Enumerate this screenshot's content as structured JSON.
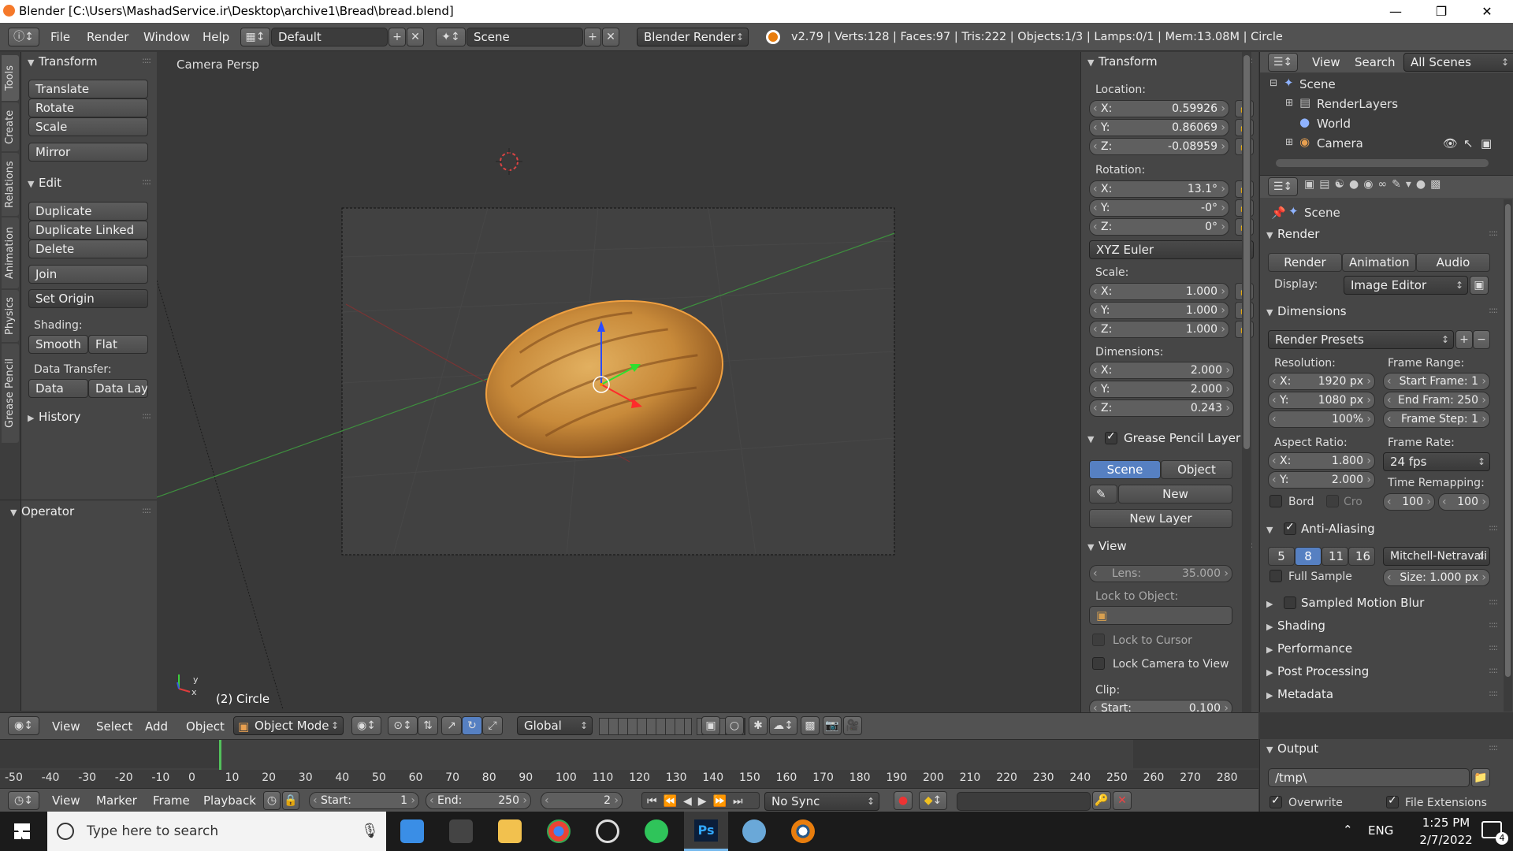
{
  "window": {
    "title": "Blender [C:\\Users\\MashadService.ir\\Desktop\\archive1\\Bread\\bread.blend]"
  },
  "info": {
    "menus": [
      "File",
      "Render",
      "Window",
      "Help"
    ],
    "layout": "Default",
    "scene": "Scene",
    "engine": "Blender Render",
    "stats": "v2.79 | Verts:128 | Faces:97 | Tris:222 | Objects:1/3 | Lamps:0/1 | Mem:13.08M | Circle"
  },
  "tabs": [
    "Tools",
    "Create",
    "Relations",
    "Animation",
    "Physics",
    "Grease Pencil"
  ],
  "tools": {
    "transform_title": "Transform",
    "translate": "Translate",
    "rotate": "Rotate",
    "scale": "Scale",
    "mirror": "Mirror",
    "edit_title": "Edit",
    "duplicate": "Duplicate",
    "duplicate_linked": "Duplicate Linked",
    "delete": "Delete",
    "join": "Join",
    "set_origin": "Set Origin",
    "shading_label": "Shading:",
    "smooth": "Smooth",
    "flat": "Flat",
    "data_transfer_label": "Data Transfer:",
    "data": "Data",
    "data_lay": "Data Lay",
    "history": "History",
    "operator": "Operator"
  },
  "viewport": {
    "label": "Camera Persp",
    "object_label": "(2) Circle",
    "axis_x": "x",
    "axis_y": "y",
    "menus": [
      "View",
      "Select",
      "Add",
      "Object"
    ],
    "mode": "Object Mode",
    "orientation": "Global"
  },
  "npanel": {
    "transform_title": "Transform",
    "location_label": "Location:",
    "location": [
      {
        "k": "X:",
        "v": "0.59926"
      },
      {
        "k": "Y:",
        "v": "0.86069"
      },
      {
        "k": "Z:",
        "v": "-0.08959"
      }
    ],
    "rotation_label": "Rotation:",
    "rotation": [
      {
        "k": "X:",
        "v": "13.1°"
      },
      {
        "k": "Y:",
        "v": "-0°"
      },
      {
        "k": "Z:",
        "v": "0°"
      }
    ],
    "rotation_mode": "XYZ Euler",
    "scale_label": "Scale:",
    "scale": [
      {
        "k": "X:",
        "v": "1.000"
      },
      {
        "k": "Y:",
        "v": "1.000"
      },
      {
        "k": "Z:",
        "v": "1.000"
      }
    ],
    "dimensions_label": "Dimensions:",
    "dimensions": [
      {
        "k": "X:",
        "v": "2.000"
      },
      {
        "k": "Y:",
        "v": "2.000"
      },
      {
        "k": "Z:",
        "v": "0.243"
      }
    ],
    "gp_title": "Grease Pencil Layer",
    "gp_scene": "Scene",
    "gp_object": "Object",
    "gp_new": "New",
    "gp_new_layer": "New Layer",
    "view_title": "View",
    "lens_label": "Lens:",
    "lens_value": "35.000",
    "lock_to_object": "Lock to Object:",
    "lock_to_cursor": "Lock to Cursor",
    "lock_camera": "Lock Camera to View",
    "clip_label": "Clip:",
    "clip_start_label": "Start:",
    "clip_start_value": "0.100"
  },
  "outliner": {
    "view": "View",
    "search": "Search",
    "filter": "All Scenes",
    "items": [
      "Scene",
      "RenderLayers",
      "World",
      "Camera"
    ]
  },
  "props": {
    "context": "Scene",
    "render_title": "Render",
    "render_btn": "Render",
    "animation_btn": "Animation",
    "audio_btn": "Audio",
    "display_label": "Display:",
    "display_value": "Image Editor",
    "dimensions_title": "Dimensions",
    "presets": "Render Presets",
    "resolution_label": "Resolution:",
    "res_x": "1920 px",
    "res_y": "1080 px",
    "res_pct": "100%",
    "frame_range_label": "Frame Range:",
    "start_frame": "Start Frame: 1",
    "end_frame": "End Fram: 250",
    "frame_step": "Frame Step: 1",
    "aspect_label": "Aspect Ratio:",
    "aspect_x": "1.800",
    "aspect_y": "2.000",
    "frame_rate_label": "Frame Rate:",
    "frame_rate": "24 fps",
    "time_remap_label": "Time Remapping:",
    "remap_old": "100",
    "remap_new": "100",
    "bord": "Bord",
    "cro": "Cro",
    "aa_title": "Anti-Aliasing",
    "aa_samples": [
      "5",
      "8",
      "11",
      "16"
    ],
    "aa_filter": "Mitchell-Netravali",
    "full_sample": "Full Sample",
    "size": "Size: 1.000 px",
    "sampled_motion_blur": "Sampled Motion Blur",
    "shading": "Shading",
    "performance": "Performance",
    "post_processing": "Post Processing",
    "metadata": "Metadata",
    "output": "Output",
    "output_path": "/tmp\\",
    "overwrite": "Overwrite",
    "file_extensions": "File Extensions"
  },
  "timeline": {
    "ticks": [
      "-50",
      "-40",
      "-30",
      "-20",
      "-10",
      "0",
      "10",
      "20",
      "30",
      "40",
      "50",
      "60",
      "70",
      "80",
      "90",
      "100",
      "110",
      "120",
      "130",
      "140",
      "150",
      "160",
      "170",
      "180",
      "190",
      "200",
      "210",
      "220",
      "230",
      "240",
      "250",
      "260",
      "270",
      "280"
    ],
    "menus": [
      "View",
      "Marker",
      "Frame",
      "Playback"
    ],
    "start_label": "Start:",
    "start_value": "1",
    "end_label": "End:",
    "end_value": "250",
    "current_frame": "2",
    "sync": "No Sync"
  },
  "taskbar": {
    "search_placeholder": "Type here to search",
    "lang": "ENG",
    "time": "1:25 PM",
    "date": "2/7/2022",
    "notifications": "4"
  },
  "colors": {
    "accent_blue": "#5680c2",
    "bread": "#c98a3a",
    "title_bg": "#ffffff",
    "taskbar": "#1b1b1b"
  }
}
